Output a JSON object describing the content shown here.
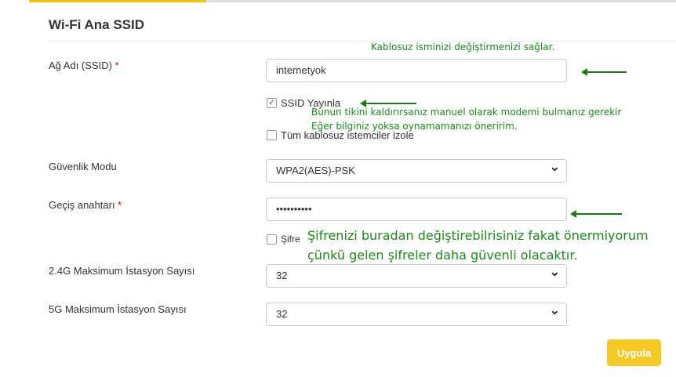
{
  "section_title": "Wi-Fi Ana SSID",
  "fields": {
    "ssid": {
      "label": "Ağ Adı (SSID)",
      "required": "*",
      "value": "internetyok"
    },
    "broadcast": {
      "label": "SSID Yayınla",
      "checked": true
    },
    "isolate": {
      "label": "Tüm kablosuz istemciler izole",
      "checked": false
    },
    "security": {
      "label": "Güvenlik Modu",
      "value": "WPA2(AES)-PSK"
    },
    "passphrase": {
      "label": "Geçiş anahtarı",
      "required": "*",
      "value": "••••••••••"
    },
    "show_password": {
      "label": "Şifre",
      "checked": false
    },
    "max24": {
      "label": "2.4G Maksimum İstasyon Sayısı",
      "value": "32"
    },
    "max5": {
      "label": "5G Maksimum İstasyon Sayısı",
      "value": "32"
    }
  },
  "apply_label": "Uygula",
  "annotations": {
    "ssid_note": "Kablosuz isminizi değiştirmenizi sağlar.",
    "broadcast_note1": "Bunun tikini kaldırırsanız manuel olarak modemi bulmanız gerekir",
    "broadcast_note2": "Eğer bilginiz yoksa oynamamanızı öneririm.",
    "password_note1": "Şifrenizi buradan değiştirebilrisiniz fakat önermiyorum",
    "password_note2": "çünkü gelen şifreler daha güvenli olacaktır."
  },
  "colors": {
    "accent": "#f5c400",
    "annotation": "#1a8a1a"
  }
}
